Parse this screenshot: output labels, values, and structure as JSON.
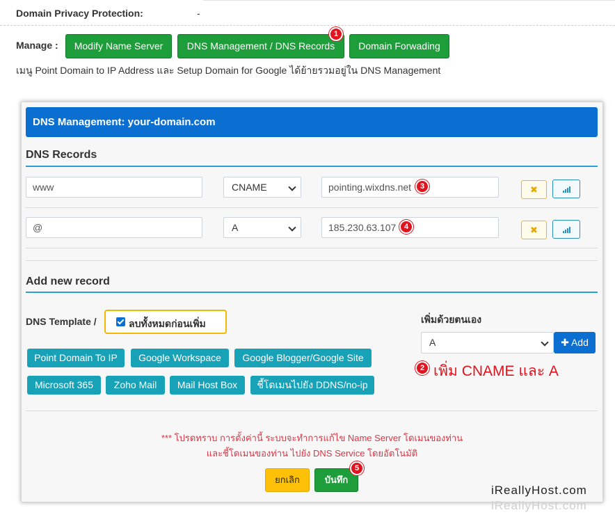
{
  "privacy": {
    "label": "Domain Privacy Protection:",
    "value": "-"
  },
  "manage": {
    "label": "Manage :",
    "buttons": [
      "Modify Name Server",
      "DNS Management / DNS Records",
      "Domain Forwading"
    ],
    "note": "เมนู Point Domain to IP Address และ Setup Domain for Google ได้ย้ายรวมอยู่ใน DNS Management"
  },
  "panel": {
    "title": "DNS Management: your-domain.com",
    "records_title": "DNS Records",
    "records": [
      {
        "name": "www",
        "type": "CNAME",
        "value": "pointing.wixdns.net"
      },
      {
        "name": "@",
        "type": "A",
        "value": "185.230.63.107"
      }
    ],
    "delete_icon": "x-icon",
    "stats_icon": "signal-icon",
    "add_title": "Add new record",
    "template_label": "DNS Template /",
    "clear_label": "ลบทั้งหมดก่อนเพิ่ม",
    "templates": [
      "Point Domain To IP",
      "Google Workspace",
      "Google Blogger/Google Site",
      "Microsoft 365",
      "Zoho Mail",
      "Mail Host Box",
      "ชี้โดเมนไปยัง DDNS/no-ip"
    ],
    "self_label": "เพิ่มด้วยตนเอง",
    "self_select": "A",
    "add_button": "Add",
    "add_note": "เพิ่ม CNAME และ  A",
    "warning_1": "*** โปรดทราบ การตั้งค่านี้ ระบบจะทำการแก้ไข Name Server โดเมนของท่าน",
    "warning_2": "และชี้โดเมนของท่าน ไปยัง DNS Service โดยอัตโนมัติ",
    "cancel": "ยกเลิก",
    "save": "บันทึก"
  },
  "badges": [
    "1",
    "2",
    "3",
    "4",
    "5"
  ],
  "watermark": "iReallyHost.com",
  "colors": {
    "primary": "#0a6fd1",
    "success": "#1e9e3a",
    "warning": "#f5b800",
    "info": "#17a2b8",
    "danger": "#e0141e"
  }
}
